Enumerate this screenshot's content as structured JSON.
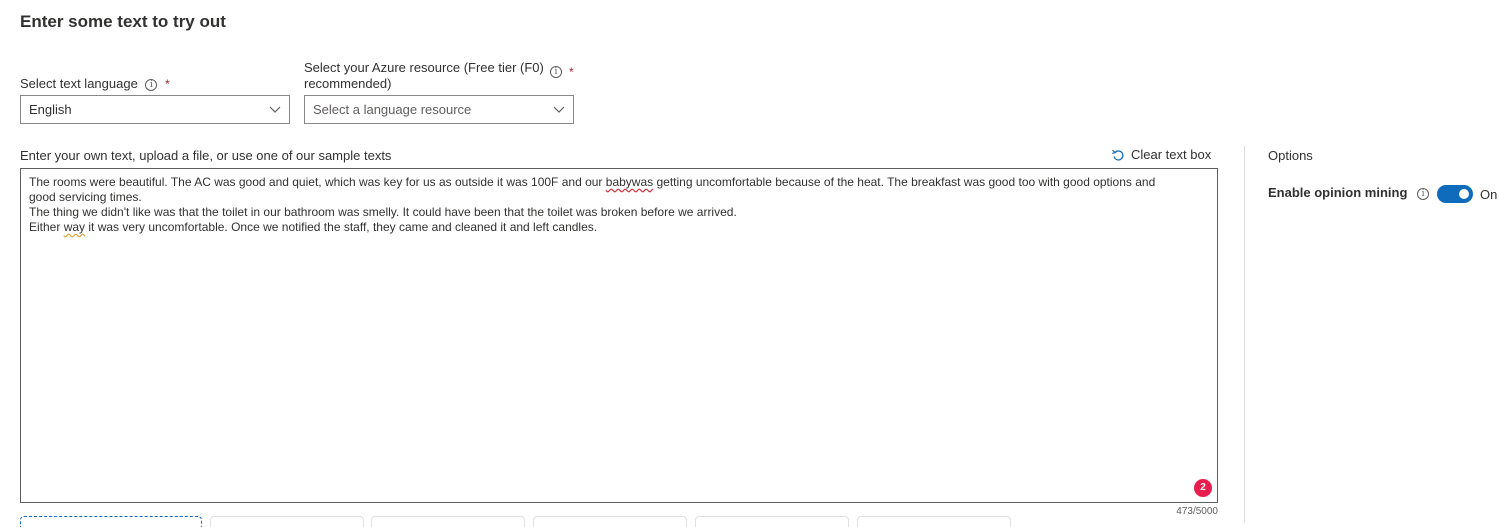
{
  "heading": "Enter some text to try out",
  "language": {
    "label": "Select text language",
    "required_mark": "*",
    "value": "English"
  },
  "resource": {
    "label_line1": "Select your Azure resource (Free tier (F0)",
    "label_line2": "recommended)",
    "required_mark": "*",
    "placeholder": "Select a language resource"
  },
  "input": {
    "label": "Enter your own text, upload a file, or use one of our sample texts",
    "clear_label": "Clear text box",
    "line1_a": "The rooms were beautiful. The AC was good and quiet, which was key for us as outside it was 100F and our ",
    "line1_err": "babywas",
    "line1_b": " getting uncomfortable because of the heat. The breakfast was good too with good options and",
    "line2": "good servicing times.",
    "line3": "The thing we didn't like was that the toilet in our bathroom was smelly. It could have been that the toilet was broken before we arrived.",
    "line4_a": "Either ",
    "line4_warn": "way",
    "line4_b": " it was very uncomfortable. Once we notified the staff, they came and cleaned it and left candles.",
    "issue_count": "2",
    "char_count": "473/5000"
  },
  "options": {
    "title": "Options",
    "opinion_mining_label": "Enable opinion mining",
    "opinion_mining_state": "On",
    "opinion_mining_enabled": true
  },
  "colors": {
    "accent": "#0f6cbd",
    "required": "#a4262c",
    "badge": "#e81e4e"
  }
}
